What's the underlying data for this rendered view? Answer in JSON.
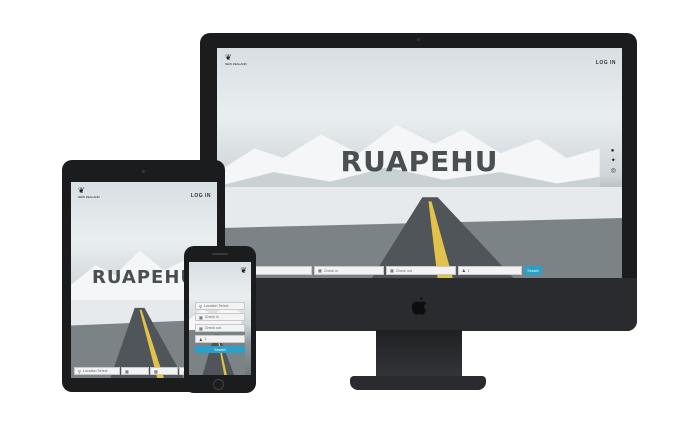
{
  "brand": {
    "logo_line1": "NEW ZEALAND",
    "logo_line2": ""
  },
  "nav": {
    "login": "LOG IN"
  },
  "hero": {
    "title": "RUAPEHU"
  },
  "search": {
    "location_placeholder": "Location Select",
    "checkin_placeholder": "Check in",
    "checkout_placeholder": "Check out",
    "guests_value": "1",
    "search_label": "Search"
  },
  "social": [
    "facebook-icon",
    "twitter-icon",
    "instagram-icon"
  ],
  "colors": {
    "accent": "#2aa1c8",
    "bezel": "#1b1c1e",
    "title": "#4a4f52"
  }
}
